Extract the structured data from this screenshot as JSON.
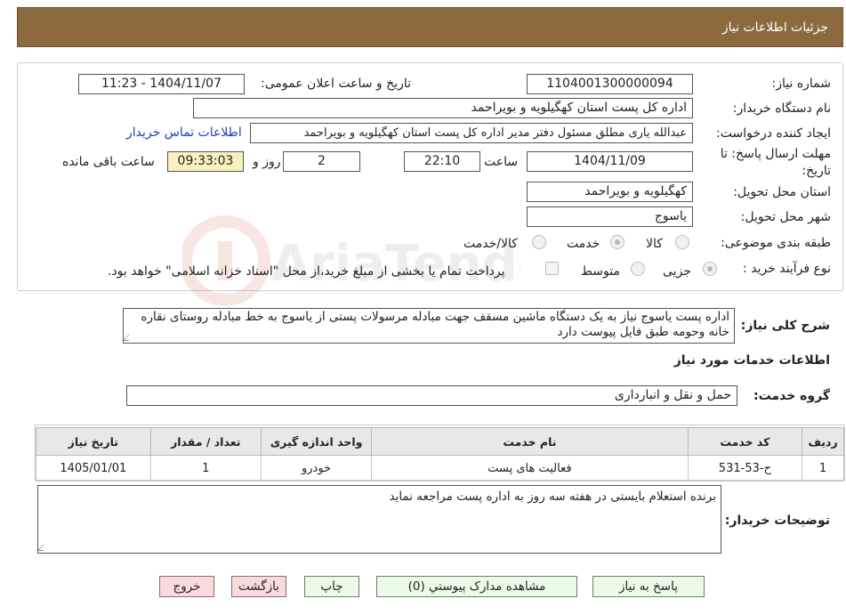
{
  "header": {
    "title": "جزئیات اطلاعات نیاز"
  },
  "form": {
    "need_number": {
      "label": "شماره نیاز:",
      "value": "1104001300000094"
    },
    "announce_datetime": {
      "label": "تاریخ و ساعت اعلان عمومی:",
      "value": "1404/11/07 - 11:23"
    },
    "buyer_org": {
      "label": "نام دستگاه خریدار:",
      "value": "اداره کل پست استان کهگیلویه و بویراحمد"
    },
    "requester": {
      "label": "ایجاد کننده درخواست:",
      "value": "عبدالله یاری مطلق مسئول دفتر مدیر اداره کل پست استان کهگیلویه و بویراحمد",
      "contact_link": "اطلاعات تماس خریدار"
    },
    "deadline": {
      "label_line1": "مهلت ارسال پاسخ: تا",
      "label_line2": "تاریخ:",
      "date": "1404/11/09",
      "time_label": "ساعت",
      "time": "22:10",
      "days": "2",
      "days_label": "روز و",
      "remaining": "09:33:03",
      "remaining_label": "ساعت باقی مانده"
    },
    "delivery_province": {
      "label": "استان محل تحویل:",
      "value": "کهگیلویه و بویراحمد"
    },
    "delivery_city": {
      "label": "شهر محل تحویل:",
      "value": "یاسوج"
    },
    "category": {
      "label": "طبقه بندی موضوعی:",
      "options": [
        "کالا",
        "خدمت",
        "کالا/خدمت"
      ],
      "selected": "خدمت"
    },
    "purchase_type": {
      "label": "نوع فرآیند خرید :",
      "options": [
        "جزیی",
        "متوسط"
      ],
      "selected": "جزیی",
      "payment_note": "پرداخت تمام یا بخشی از مبلغ خرید،از محل \"اسناد خزانه اسلامی\" خواهد بود."
    }
  },
  "description": {
    "label": "شرح کلی نیاز:",
    "text": "اداره پست یاسوج نیاز به یک دستگاه  ماشین مسقف جهت  مبادله مرسولات پستی از یاسوج به خط مبادله روستای نقاره خانه وحومه  طبق  فایل پیوست دارد"
  },
  "services": {
    "section_title": "اطلاعات خدمات مورد نیاز",
    "group_label": "گروه خدمت:",
    "group_value": "حمل و نقل و انبارداری",
    "table": {
      "headers": [
        "ردیف",
        "کد خدمت",
        "نام خدمت",
        "واحد اندازه گیری",
        "تعداد / مقدار",
        "تاریخ نیاز"
      ],
      "rows": [
        [
          "1",
          "ح-53-531",
          "فعالیت های پست",
          "خودرو",
          "1",
          "1405/01/01"
        ]
      ]
    }
  },
  "buyer_notes": {
    "label": "توضیحات خریدار:",
    "text": "برنده استعلام بایستی در هفته سه روز به اداره پست مراجعه نماید"
  },
  "buttons": {
    "reply": "پاسخ به نیاز",
    "attachments": "مشاهده مدارک پیوستي (0)",
    "print": "چاپ",
    "back": "بازگشت",
    "exit": "خروج"
  },
  "watermark_text": "AriaTender.neT",
  "colors": {
    "header_bg": "#8d6a3e",
    "remaining_bg": "#f9f1bd",
    "button_green": "#eafbe6",
    "button_pink": "#fbd9dd",
    "link": "#1a3fc0"
  }
}
